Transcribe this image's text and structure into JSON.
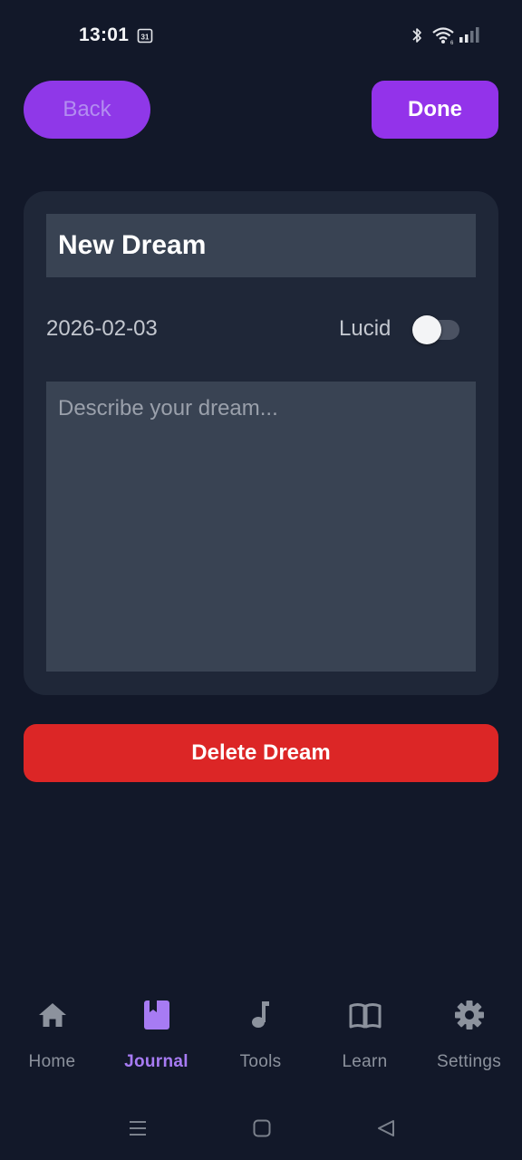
{
  "status_bar": {
    "time": "13:01",
    "calendar_day": "31",
    "icons": [
      "calendar-icon",
      "bluetooth-icon",
      "wifi-icon",
      "signal-icon"
    ]
  },
  "header": {
    "back_label": "Back",
    "done_label": "Done"
  },
  "dream": {
    "title_value": "New Dream",
    "date": "2026-02-03",
    "lucid_label": "Lucid",
    "lucid_enabled": false,
    "description_value": "",
    "description_placeholder": "Describe your dream..."
  },
  "delete_label": "Delete Dream",
  "bottom_nav": {
    "active": "Journal",
    "items": [
      {
        "label": "Home",
        "icon": "home-icon"
      },
      {
        "label": "Journal",
        "icon": "journal-icon"
      },
      {
        "label": "Tools",
        "icon": "music-note-icon"
      },
      {
        "label": "Learn",
        "icon": "book-icon"
      },
      {
        "label": "Settings",
        "icon": "gear-icon"
      }
    ]
  },
  "colors": {
    "background": "#121829",
    "card": "#1f2738",
    "input": "#394353",
    "accent": "#9333ea",
    "danger": "#dc2626",
    "nav_active": "#a77bf3",
    "nav_inactive": "#8c929d"
  }
}
